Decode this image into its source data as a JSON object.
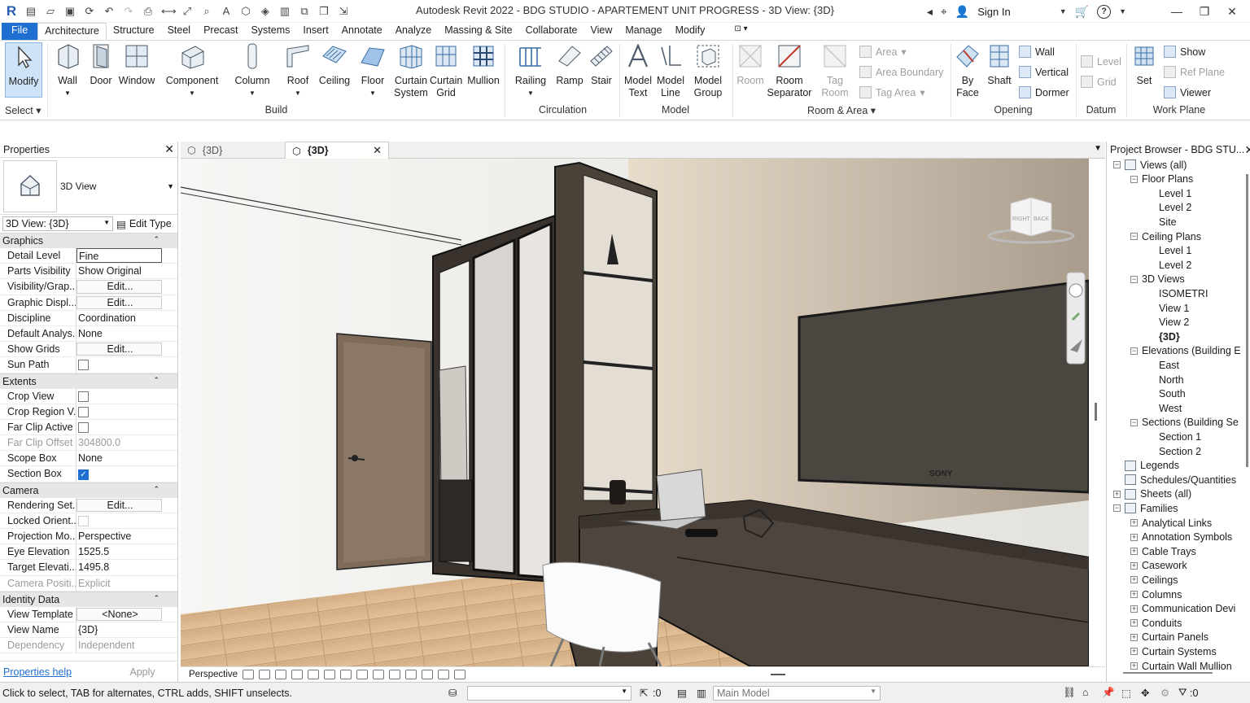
{
  "titlebar": {
    "title": "Autodesk Revit 2022 - BDG STUDIO - APARTEMENT UNIT PROGRESS - 3D View: {3D}",
    "sign_in": "Sign In",
    "help": "?"
  },
  "menu": {
    "file": "File",
    "tabs": [
      "Architecture",
      "Structure",
      "Steel",
      "Precast",
      "Systems",
      "Insert",
      "Annotate",
      "Analyze",
      "Massing & Site",
      "Collaborate",
      "View",
      "Manage",
      "Modify"
    ]
  },
  "ribbon": {
    "modify": "Modify",
    "select": "Select",
    "build": {
      "label": "Build",
      "wall": "Wall",
      "door": "Door",
      "window": "Window",
      "component": "Component",
      "column": "Column",
      "roof": "Roof",
      "ceiling": "Ceiling",
      "floor": "Floor",
      "curtain_system": "Curtain\nSystem",
      "curtain_grid": "Curtain\nGrid",
      "mullion": "Mullion"
    },
    "circulation": {
      "label": "Circulation",
      "railing": "Railing",
      "ramp": "Ramp",
      "stair": "Stair"
    },
    "model": {
      "label": "Model",
      "model_text": "Model\nText",
      "model_line": "Model\nLine",
      "model_group": "Model\nGroup"
    },
    "room_area": {
      "label": "Room & Area",
      "room": "Room",
      "room_separator": "Room\nSeparator",
      "tag_room": "Tag\nRoom",
      "area": "Area",
      "area_boundary": "Area  Boundary",
      "tag_area": "Tag  Area"
    },
    "opening": {
      "label": "Opening",
      "by_face": "By\nFace",
      "shaft": "Shaft",
      "wall": "Wall",
      "vertical": "Vertical",
      "dormer": "Dormer"
    },
    "datum": {
      "label": "Datum",
      "level": "Level",
      "grid": "Grid"
    },
    "work_plane": {
      "label": "Work Plane",
      "set": "Set",
      "show": "Show",
      "ref_plane": "Ref  Plane",
      "viewer": "Viewer"
    }
  },
  "properties": {
    "title": "Properties",
    "type_name": "3D View",
    "selector": "3D View: {3D}",
    "edit_type": "Edit Type",
    "groups": [
      {
        "name": "Graphics",
        "rows": [
          {
            "k": "Detail Level",
            "v": "Fine",
            "style": "boxed"
          },
          {
            "k": "Parts Visibility",
            "v": "Show Original"
          },
          {
            "k": "Visibility/Grap...",
            "v": "Edit...",
            "style": "btn"
          },
          {
            "k": "Graphic Displ...",
            "v": "Edit...",
            "style": "btn"
          },
          {
            "k": "Discipline",
            "v": "Coordination"
          },
          {
            "k": "Default Analys...",
            "v": "None"
          },
          {
            "k": "Show Grids",
            "v": "Edit...",
            "style": "btn"
          },
          {
            "k": "Sun Path",
            "v": "",
            "style": "cb"
          }
        ]
      },
      {
        "name": "Extents",
        "rows": [
          {
            "k": "Crop View",
            "v": "",
            "style": "cb"
          },
          {
            "k": "Crop Region V...",
            "v": "",
            "style": "cb"
          },
          {
            "k": "Far Clip Active",
            "v": "",
            "style": "cb"
          },
          {
            "k": "Far Clip Offset",
            "v": "304800.0",
            "style": "grey"
          },
          {
            "k": "Scope Box",
            "v": "None"
          },
          {
            "k": "Section Box",
            "v": "✓",
            "style": "cbon"
          }
        ]
      },
      {
        "name": "Camera",
        "rows": [
          {
            "k": "Rendering Set...",
            "v": "Edit...",
            "style": "btn"
          },
          {
            "k": "Locked Orient...",
            "v": "",
            "style": "cbdis"
          },
          {
            "k": "Projection Mo...",
            "v": "Perspective"
          },
          {
            "k": "Eye Elevation",
            "v": "1525.5"
          },
          {
            "k": "Target Elevati...",
            "v": "1495.8"
          },
          {
            "k": "Camera Positi...",
            "v": "Explicit",
            "style": "grey"
          }
        ]
      },
      {
        "name": "Identity Data",
        "rows": [
          {
            "k": "View Template",
            "v": "<None>",
            "style": "btn"
          },
          {
            "k": "View Name",
            "v": "{3D}"
          },
          {
            "k": "Dependency",
            "v": "Independent",
            "style": "grey"
          }
        ]
      }
    ],
    "help": "Properties help",
    "apply": "Apply"
  },
  "view_tabs": [
    {
      "label": "{3D}",
      "active": false
    },
    {
      "label": "{3D}",
      "active": true
    }
  ],
  "viewcube": {
    "right": "RIGHT",
    "back": "BACK"
  },
  "tv_brand": "SONY",
  "view_bar": {
    "mode": "Perspective"
  },
  "browser": {
    "title": "Project Browser - BDG STU...",
    "items": [
      {
        "t": "Views (all)",
        "lvl": 0,
        "tog": "−",
        "icon": true
      },
      {
        "t": "Floor Plans",
        "lvl": 1,
        "tog": "−"
      },
      {
        "t": "Level 1",
        "lvl": 2
      },
      {
        "t": "Level 2",
        "lvl": 2
      },
      {
        "t": "Site",
        "lvl": 2
      },
      {
        "t": "Ceiling Plans",
        "lvl": 1,
        "tog": "−"
      },
      {
        "t": "Level 1",
        "lvl": 2
      },
      {
        "t": "Level 2",
        "lvl": 2
      },
      {
        "t": "3D Views",
        "lvl": 1,
        "tog": "−"
      },
      {
        "t": "ISOMETRI",
        "lvl": 2
      },
      {
        "t": "View 1",
        "lvl": 2
      },
      {
        "t": "View 2",
        "lvl": 2
      },
      {
        "t": "{3D}",
        "lvl": 2,
        "bold": true
      },
      {
        "t": "Elevations (Building E",
        "lvl": 1,
        "tog": "−"
      },
      {
        "t": "East",
        "lvl": 2
      },
      {
        "t": "North",
        "lvl": 2
      },
      {
        "t": "South",
        "lvl": 2
      },
      {
        "t": "West",
        "lvl": 2
      },
      {
        "t": "Sections (Building Se",
        "lvl": 1,
        "tog": "−"
      },
      {
        "t": "Section 1",
        "lvl": 2
      },
      {
        "t": "Section 2",
        "lvl": 2
      },
      {
        "t": "Legends",
        "lvl": 0,
        "icon": true
      },
      {
        "t": "Schedules/Quantities",
        "lvl": 0,
        "icon": true
      },
      {
        "t": "Sheets (all)",
        "lvl": 0,
        "tog": "+",
        "icon": true
      },
      {
        "t": "Families",
        "lvl": 0,
        "tog": "−",
        "icon": true
      },
      {
        "t": "Analytical Links",
        "lvl": 1,
        "tog": "+"
      },
      {
        "t": "Annotation Symbols",
        "lvl": 1,
        "tog": "+"
      },
      {
        "t": "Cable Trays",
        "lvl": 1,
        "tog": "+"
      },
      {
        "t": "Casework",
        "lvl": 1,
        "tog": "+"
      },
      {
        "t": "Ceilings",
        "lvl": 1,
        "tog": "+"
      },
      {
        "t": "Columns",
        "lvl": 1,
        "tog": "+"
      },
      {
        "t": "Communication Devi",
        "lvl": 1,
        "tog": "+"
      },
      {
        "t": "Conduits",
        "lvl": 1,
        "tog": "+"
      },
      {
        "t": "Curtain Panels",
        "lvl": 1,
        "tog": "+"
      },
      {
        "t": "Curtain Systems",
        "lvl": 1,
        "tog": "+"
      },
      {
        "t": "Curtain Wall Mullion",
        "lvl": 1,
        "tog": "+"
      }
    ]
  },
  "status": {
    "hint": "Click to select, TAB for alternates, CTRL adds, SHIFT unselects.",
    "coord": ":0",
    "model": "Main Model",
    "filter": ":0"
  }
}
